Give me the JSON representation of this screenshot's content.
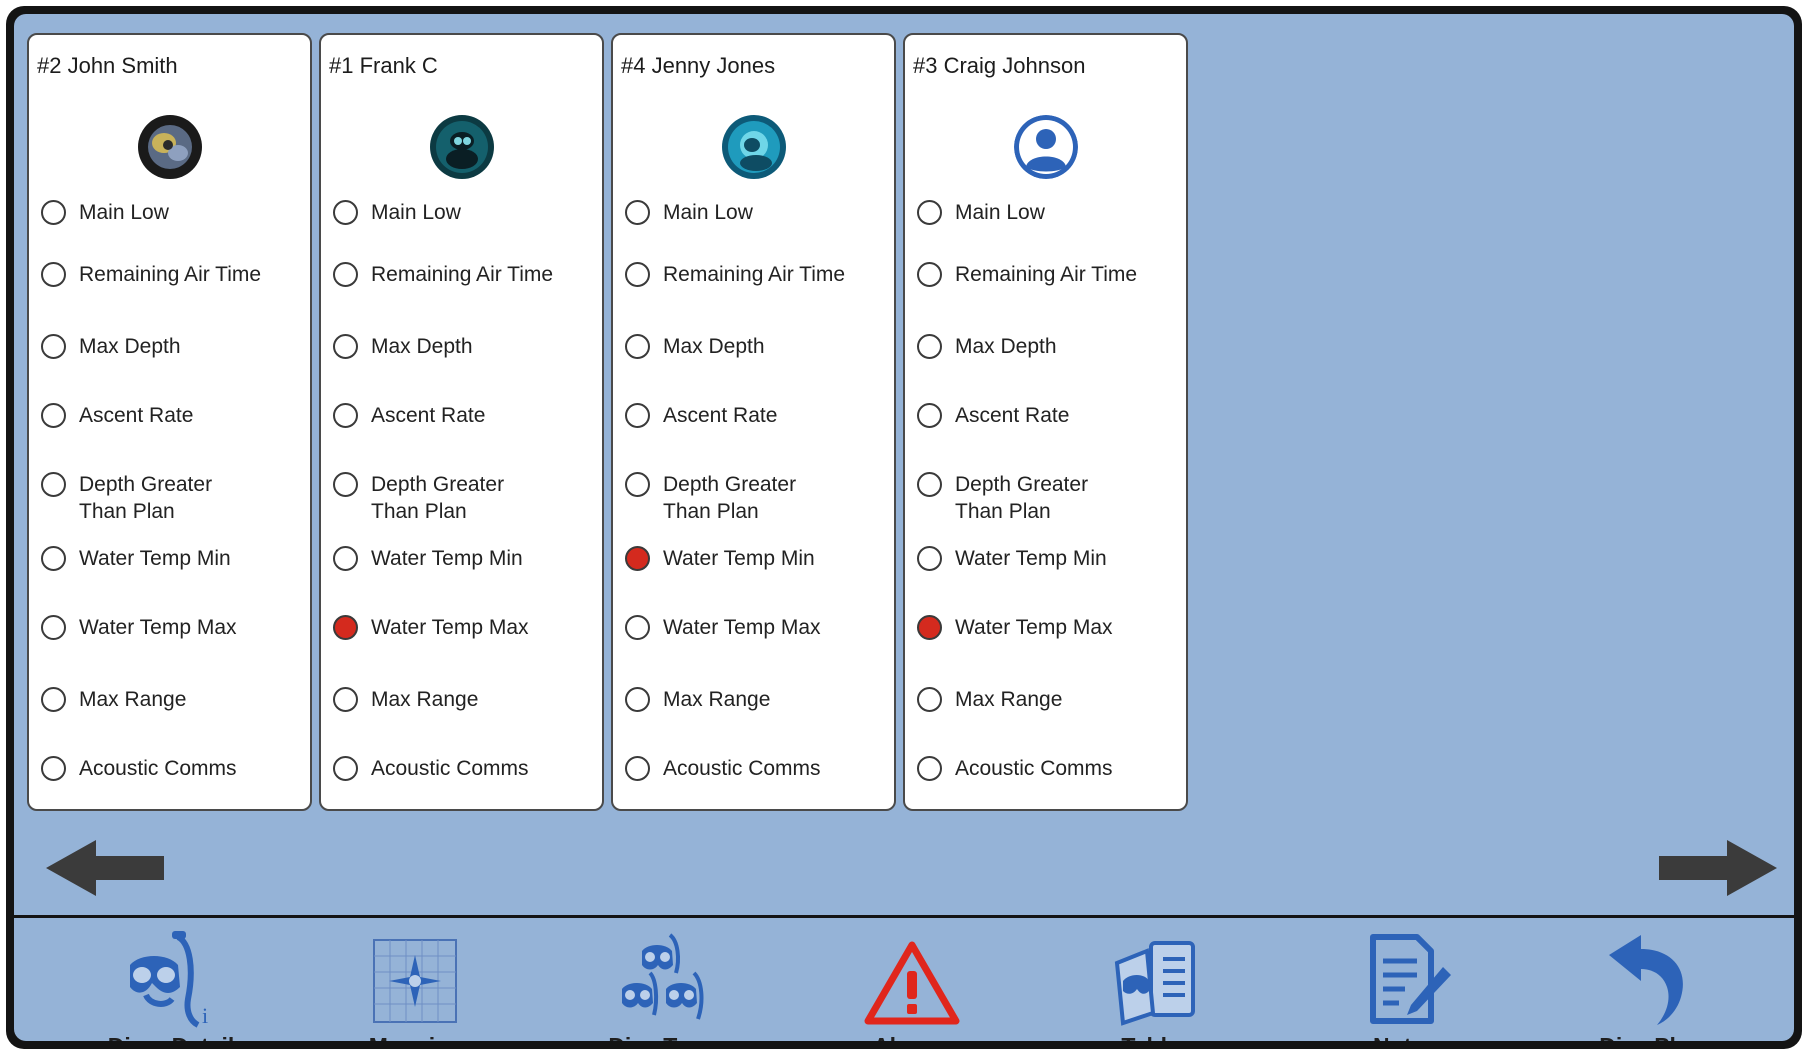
{
  "divers": [
    {
      "name": "#2 John Smith",
      "avatar": "diver-photo-1",
      "alarms": [
        {
          "label": "Main Low",
          "active": false
        },
        {
          "label": "Remaining Air Time",
          "active": false
        },
        {
          "label": "Max Depth",
          "active": false
        },
        {
          "label": "Ascent Rate",
          "active": false
        },
        {
          "label": "Depth Greater Than Plan",
          "active": false
        },
        {
          "label": "Water Temp Min",
          "active": false
        },
        {
          "label": "Water Temp Max",
          "active": false
        },
        {
          "label": "Max Range",
          "active": false
        },
        {
          "label": "Acoustic Comms",
          "active": false
        }
      ]
    },
    {
      "name": "#1 Frank C",
      "avatar": "diver-photo-2",
      "alarms": [
        {
          "label": "Main Low",
          "active": false
        },
        {
          "label": "Remaining Air Time",
          "active": false
        },
        {
          "label": "Max Depth",
          "active": false
        },
        {
          "label": "Ascent Rate",
          "active": false
        },
        {
          "label": "Depth Greater Than Plan",
          "active": false
        },
        {
          "label": "Water Temp Min",
          "active": false
        },
        {
          "label": "Water Temp Max",
          "active": true
        },
        {
          "label": "Max Range",
          "active": false
        },
        {
          "label": "Acoustic Comms",
          "active": false
        }
      ]
    },
    {
      "name": "#4 Jenny Jones",
      "avatar": "diver-photo-3",
      "alarms": [
        {
          "label": "Main Low",
          "active": false
        },
        {
          "label": "Remaining Air Time",
          "active": false
        },
        {
          "label": "Max Depth",
          "active": false
        },
        {
          "label": "Ascent Rate",
          "active": false
        },
        {
          "label": "Depth Greater Than Plan",
          "active": false
        },
        {
          "label": "Water Temp Min",
          "active": true
        },
        {
          "label": "Water Temp Max",
          "active": false
        },
        {
          "label": "Max Range",
          "active": false
        },
        {
          "label": "Acoustic Comms",
          "active": false
        }
      ]
    },
    {
      "name": "#3 Craig Johnson",
      "avatar": "default-user-icon",
      "alarms": [
        {
          "label": "Main Low",
          "active": false
        },
        {
          "label": "Remaining Air Time",
          "active": false
        },
        {
          "label": "Max Depth",
          "active": false
        },
        {
          "label": "Ascent Rate",
          "active": false
        },
        {
          "label": "Depth Greater Than Plan",
          "active": false
        },
        {
          "label": "Water Temp Min",
          "active": false
        },
        {
          "label": "Water Temp Max",
          "active": true
        },
        {
          "label": "Max Range",
          "active": false
        },
        {
          "label": "Acoustic Comms",
          "active": false
        }
      ]
    }
  ],
  "pager": {
    "prev_icon": "left-arrow-icon",
    "next_icon": "right-arrow-icon"
  },
  "toolbar": [
    {
      "label": "Diver Detail",
      "icon": "diver-mask-icon"
    },
    {
      "label": "Mapping",
      "icon": "map-grid-icon"
    },
    {
      "label": "Dive Team",
      "icon": "dive-team-icon"
    },
    {
      "label": "Alarms",
      "icon": "warning-triangle-icon"
    },
    {
      "label": "Tables",
      "icon": "tables-icon"
    },
    {
      "label": "Notes",
      "icon": "notes-icon"
    },
    {
      "label": "Dive Plan",
      "icon": "back-arrow-icon"
    }
  ],
  "colors": {
    "background": "#95b3d7",
    "active_alarm": "#d42a1e",
    "icon_blue": "#2d63b8",
    "alarm_red": "#e0261c"
  }
}
